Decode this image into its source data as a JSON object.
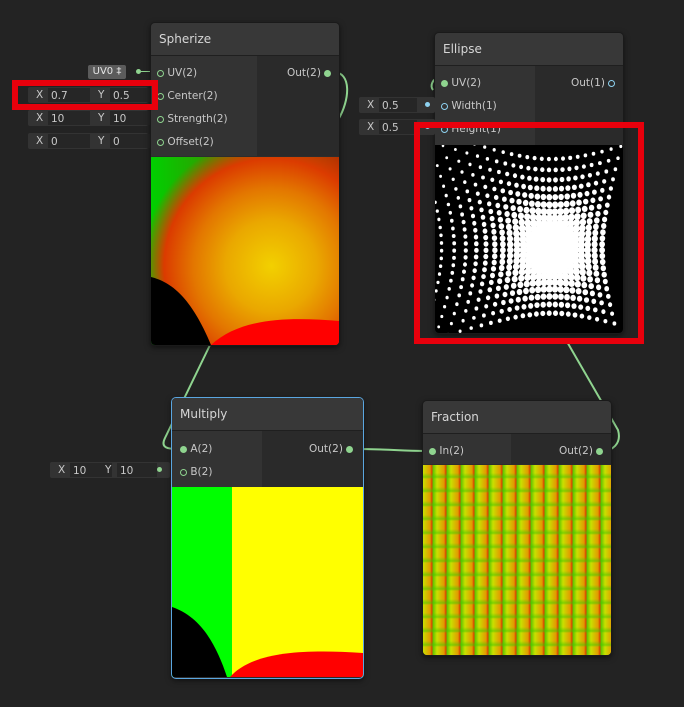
{
  "nodes": {
    "spherize": {
      "title": "Spherize",
      "inputs": [
        "UV(2)",
        "Center(2)",
        "Strength(2)",
        "Offset(2)"
      ],
      "output": "Out(2)"
    },
    "ellipse": {
      "title": "Ellipse",
      "inputs": [
        "UV(2)",
        "Width(1)",
        "Height(1)"
      ],
      "output": "Out(1)"
    },
    "multiply": {
      "title": "Multiply",
      "inputs": [
        "A(2)",
        "B(2)"
      ],
      "output": "Out(2)"
    },
    "fraction": {
      "title": "Fraction",
      "inputs": [
        "In(2)"
      ],
      "output": "Out(2)"
    }
  },
  "fields": {
    "uv_dropdown": "UV0 ‡",
    "center": {
      "x_label": "X",
      "x": "0.7",
      "y_label": "Y",
      "y": "0.5"
    },
    "strength": {
      "x_label": "X",
      "x": "10",
      "y_label": "Y",
      "y": "10"
    },
    "offset": {
      "x_label": "X",
      "x": "0",
      "y_label": "Y",
      "y": "0"
    },
    "width": {
      "label": "X",
      "value": "0.5"
    },
    "height": {
      "label": "X",
      "value": "0.5"
    },
    "multiply_b": {
      "x_label": "X",
      "x": "10",
      "y_label": "Y",
      "y": "10"
    }
  },
  "colors": {
    "background": "#232323",
    "wire": "#8fd48f",
    "highlight": "#e8000c",
    "selection": "#5aa6e0"
  }
}
